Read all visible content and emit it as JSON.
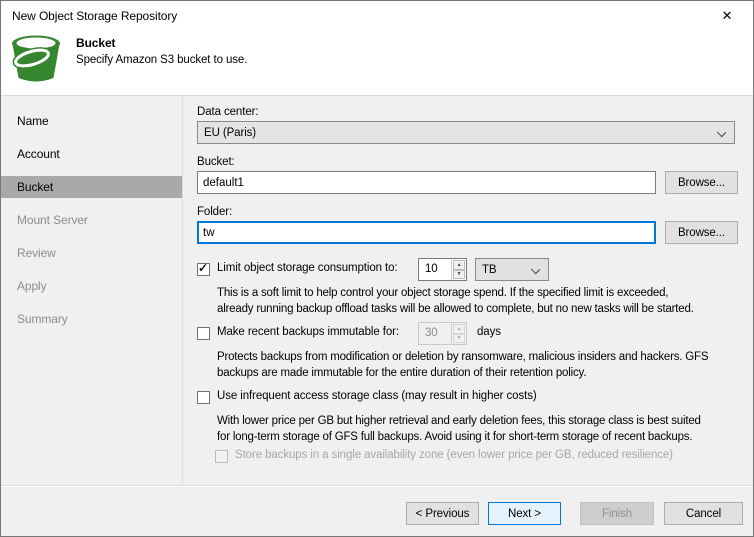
{
  "window": {
    "title": "New Object Storage Repository"
  },
  "icons": {
    "close": "✕",
    "check": "✓",
    "spin_up": "▲",
    "spin_down": "▼"
  },
  "header": {
    "title": "Bucket",
    "subtitle": "Specify Amazon S3 bucket to use."
  },
  "sidebar": {
    "items": [
      {
        "label": "Name",
        "state": "done"
      },
      {
        "label": "Account",
        "state": "done"
      },
      {
        "label": "Bucket",
        "state": "active"
      },
      {
        "label": "Mount Server",
        "state": "pending"
      },
      {
        "label": "Review",
        "state": "pending"
      },
      {
        "label": "Apply",
        "state": "pending"
      },
      {
        "label": "Summary",
        "state": "pending"
      }
    ]
  },
  "form": {
    "data_center": {
      "label": "Data center:",
      "value": "EU (Paris)"
    },
    "bucket": {
      "label": "Bucket:",
      "value": "default1",
      "browse_label": "Browse..."
    },
    "folder": {
      "label": "Folder:",
      "value": "tw",
      "browse_label": "Browse..."
    },
    "limit": {
      "label": "Limit object storage consumption to:",
      "checked": true,
      "amount": "10",
      "unit": "TB",
      "description_lines": [
        "This is a soft limit to help control your object storage spend. If the specified limit is exceeded,",
        "already running backup offload tasks will be allowed to complete, but no new tasks will be started."
      ]
    },
    "immutable": {
      "label": "Make recent backups immutable for:",
      "checked": false,
      "days_value": "30",
      "days_suffix": "days",
      "description_lines": [
        "Protects backups from modification or deletion by ransomware, malicious insiders and hackers. GFS",
        "backups are made immutable for the entire duration of their retention policy."
      ]
    },
    "infrequent": {
      "label": "Use infrequent access storage class (may result in higher costs)",
      "checked": false,
      "description_lines": [
        "With lower price per GB but higher retrieval and early deletion fees, this storage class is best suited",
        "for long-term storage of GFS full backups. Avoid using it for short-term storage of recent backups."
      ],
      "single_zone": {
        "label": "Store backups in a single availability zone (even lower price per GB, reduced resilience)",
        "checked": false
      }
    }
  },
  "footer": {
    "previous": "< Previous",
    "next": "Next >",
    "finish": "Finish",
    "cancel": "Cancel"
  },
  "colors": {
    "accent": "#0078d7",
    "accent_fill": "#e5f1fb",
    "bucket_green": "#35862f",
    "sidebar_selected": "#a9a9a9",
    "body_bg": "#f0f0f0",
    "button_bg": "#e1e1e1",
    "button_border": "#adadad"
  }
}
